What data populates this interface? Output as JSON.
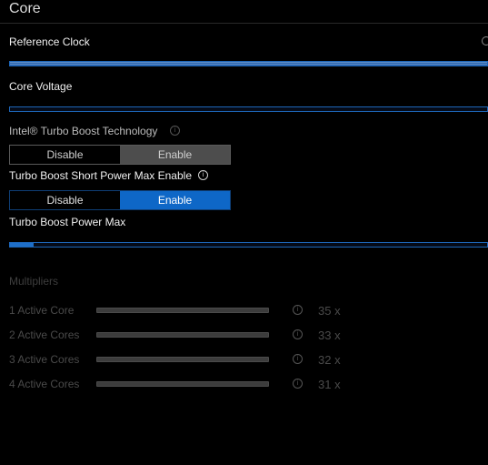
{
  "section": {
    "title": "Core"
  },
  "reference_clock": {
    "label": "Reference Clock",
    "level_percent": 100
  },
  "core_voltage": {
    "label": "Core Voltage",
    "level_percent": 0
  },
  "turbo_boost": {
    "label": "Intel® Turbo Boost Technology",
    "info_icon": "info-icon",
    "options": [
      "Disable",
      "Enable"
    ],
    "selected": "Enable"
  },
  "short_power_max_enable": {
    "label": "Turbo Boost Short Power Max Enable",
    "info_icon": "info-icon",
    "options": [
      "Disable",
      "Enable"
    ],
    "selected": "Enable"
  },
  "power_max": {
    "label": "Turbo Boost Power Max",
    "level_percent": 5
  },
  "multipliers": {
    "title": "Multipliers",
    "rows": [
      {
        "label": "1 Active Core",
        "value": "35 x"
      },
      {
        "label": "2 Active Cores",
        "value": "33 x"
      },
      {
        "label": "3 Active Cores",
        "value": "32 x"
      },
      {
        "label": "4 Active Cores",
        "value": "31 x"
      }
    ]
  },
  "colors": {
    "accent": "#0e67c7",
    "background": "#000000",
    "disabled": "#4a4a4a"
  }
}
